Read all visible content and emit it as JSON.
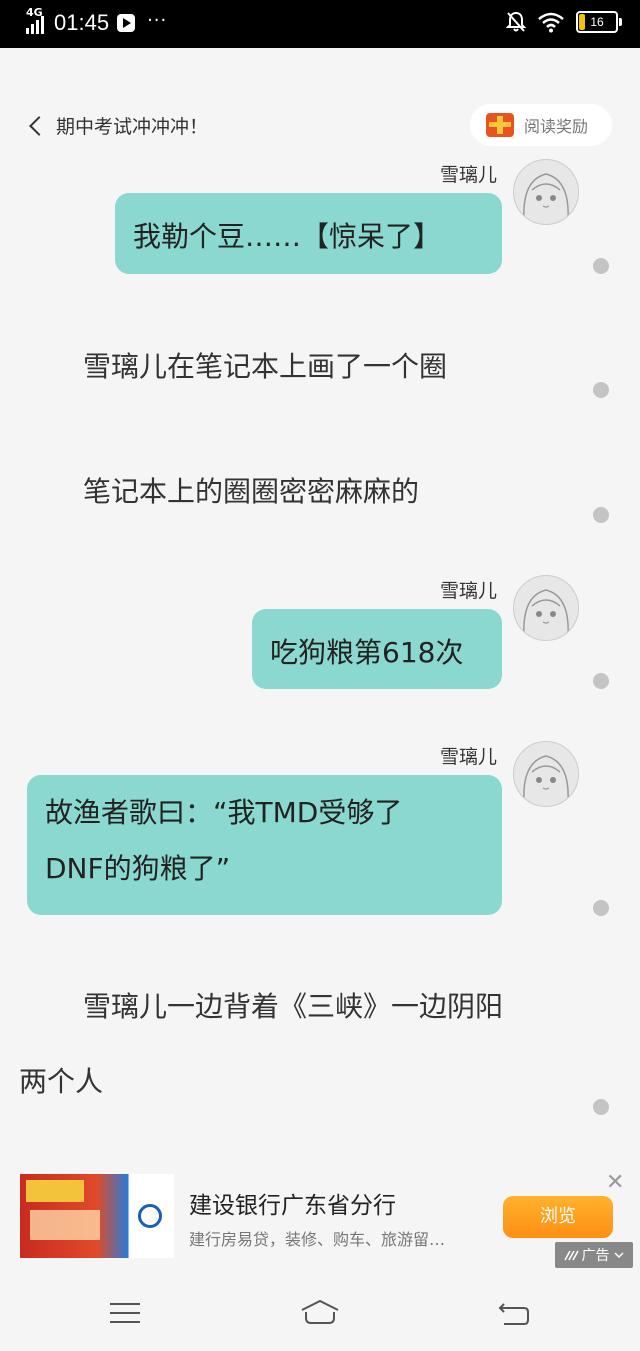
{
  "status_bar": {
    "network": "4G",
    "time": "01:45",
    "more": "···",
    "battery": "16"
  },
  "header": {
    "title": "期中考试冲冲冲！",
    "reward_label": "阅读奖励"
  },
  "messages": [
    {
      "type": "bubble",
      "name": "雪璃儿",
      "text": "我勒个豆……【惊呆了】"
    },
    {
      "type": "narration",
      "text": "雪璃儿在笔记本上画了一个圈"
    },
    {
      "type": "narration",
      "text": "笔记本上的圈圈密密麻麻的"
    },
    {
      "type": "bubble",
      "name": "雪璃儿",
      "text": "吃狗粮第618次"
    },
    {
      "type": "bubble",
      "name": "雪璃儿",
      "text_line1": "故渔者歌曰：“我TMD受够了",
      "text_line2": "DNF的狗粮了”"
    },
    {
      "type": "narration",
      "text_line1": "雪璃儿一边背着《三峡》一边阴阳",
      "text_line2": "两个人"
    }
  ],
  "ad": {
    "title": "建设银行广东省分行",
    "description": "建行房易贷，装修、购车、旅游留…",
    "button": "浏览",
    "close": "✕",
    "tag": "广告"
  },
  "icons": {
    "back": "chevron-left-icon",
    "reward": "treasure-chest-icon",
    "menu": "menu-icon",
    "home": "home-icon",
    "return": "back-icon"
  }
}
